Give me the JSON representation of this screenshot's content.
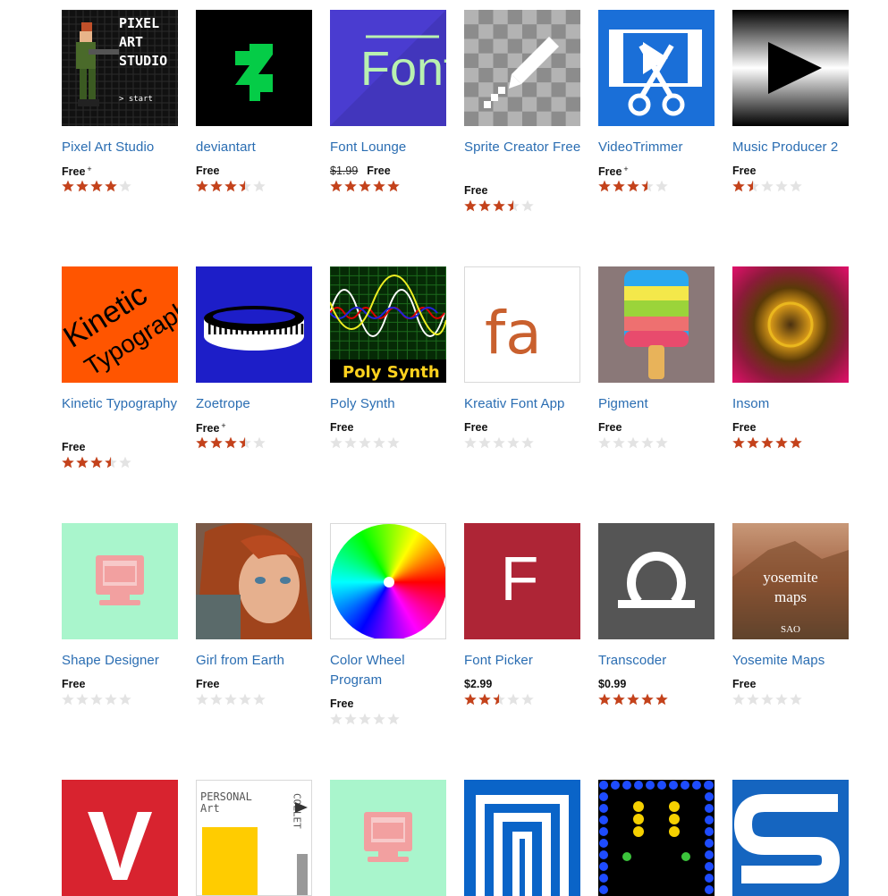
{
  "colors": {
    "link": "#2a6db2",
    "star_on": "#c4421b",
    "star_off": "#e3e3e3"
  },
  "apps": [
    {
      "name": "Pixel Art Studio",
      "price": "Free",
      "plus": true,
      "rating": 4,
      "icon": "pixel-art-studio-icon",
      "icon_text": [
        "PIXEL",
        "ART",
        "STUDIO",
        "> start"
      ]
    },
    {
      "name": "deviantart",
      "price": "Free",
      "rating": 3.5,
      "icon": "deviantart-icon"
    },
    {
      "name": "Font Lounge",
      "price": "Free",
      "old_price": "$1.99",
      "rating": 5,
      "icon": "font-lounge-icon",
      "icon_text": [
        "Font"
      ]
    },
    {
      "name": "Sprite Creator Free",
      "price": "Free",
      "rating": 3.5,
      "icon": "sprite-creator-icon"
    },
    {
      "name": "VideoTrimmer",
      "price": "Free",
      "plus": true,
      "rating": 3.5,
      "icon": "video-trimmer-icon"
    },
    {
      "name": "Music Producer 2",
      "price": "Free",
      "rating": 1.5,
      "icon": "music-producer-icon"
    },
    {
      "name": "Kinetic Typography",
      "price": "Free",
      "rating": 3.5,
      "icon": "kinetic-typography-icon",
      "icon_text": [
        "Kinetic",
        "Typography"
      ]
    },
    {
      "name": "Zoetrope",
      "price": "Free",
      "plus": true,
      "rating": 3.5,
      "icon": "zoetrope-icon"
    },
    {
      "name": "Poly Synth",
      "price": "Free",
      "rating": 0,
      "icon": "poly-synth-icon",
      "icon_text": [
        "Poly Synth"
      ]
    },
    {
      "name": "Kreativ Font App",
      "price": "Free",
      "rating": 0,
      "icon": "kreativ-font-icon",
      "icon_text": [
        "fa"
      ]
    },
    {
      "name": "Pigment",
      "price": "Free",
      "rating": 0,
      "icon": "pigment-icon"
    },
    {
      "name": "Insom",
      "price": "Free",
      "rating": 5,
      "icon": "insom-icon"
    },
    {
      "name": "Shape Designer",
      "price": "Free",
      "rating": 0,
      "icon": "shape-designer-icon"
    },
    {
      "name": "Girl from Earth",
      "price": "Free",
      "rating": 0,
      "icon": "girl-from-earth-icon"
    },
    {
      "name": "Color Wheel Program",
      "price": "Free",
      "rating": 0,
      "icon": "color-wheel-icon"
    },
    {
      "name": "Font Picker",
      "price": "$2.99",
      "rating": 2.5,
      "icon": "font-picker-icon",
      "icon_text": [
        "F"
      ]
    },
    {
      "name": "Transcoder",
      "price": "$0.99",
      "rating": 5,
      "icon": "transcoder-icon"
    },
    {
      "name": "Yosemite Maps",
      "price": "Free",
      "rating": 0,
      "icon": "yosemite-maps-icon",
      "icon_text": [
        "yosemite",
        "maps",
        "SAO"
      ]
    },
    {
      "name": "",
      "price": "",
      "rating": null,
      "icon": "v-app-icon",
      "icon_text": [
        "V"
      ]
    },
    {
      "name": "",
      "price": "",
      "rating": null,
      "icon": "personal-art-collection-icon",
      "icon_text": [
        "PERSONAL",
        "Art",
        "COLLET"
      ]
    },
    {
      "name": "",
      "price": "",
      "rating": null,
      "icon": "shape-designer-icon"
    },
    {
      "name": "",
      "price": "",
      "rating": null,
      "icon": "concentric-squares-icon"
    },
    {
      "name": "",
      "price": "",
      "rating": null,
      "icon": "dot-grid-game-icon"
    },
    {
      "name": "",
      "price": "",
      "rating": null,
      "icon": "s-app-icon"
    }
  ]
}
